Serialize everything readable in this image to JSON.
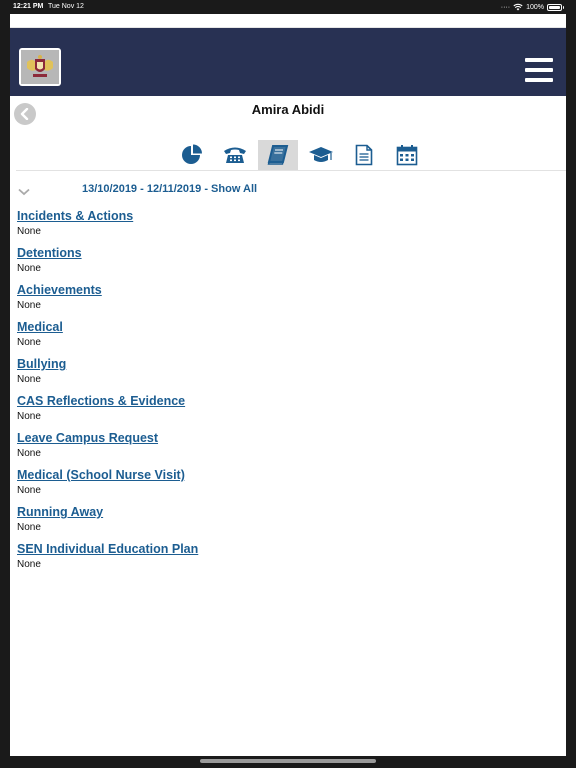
{
  "status_bar": {
    "time": "12:21 PM",
    "date": "Tue Nov 12",
    "signal": "····",
    "battery": "100%"
  },
  "header": {
    "menu_icon": "hamburger-icon",
    "logo_icon": "school-crest-icon"
  },
  "student": {
    "name": "Amira Abidi"
  },
  "tabs": [
    {
      "icon": "pie-chart-icon"
    },
    {
      "icon": "telephone-icon"
    },
    {
      "icon": "book-icon",
      "active": true
    },
    {
      "icon": "graduation-cap-icon"
    },
    {
      "icon": "document-icon"
    },
    {
      "icon": "calendar-icon"
    }
  ],
  "filter": {
    "range": "13/10/2019 - 12/11/2019 - Show All"
  },
  "sections": [
    {
      "title": "Incidents & Actions",
      "value": "None"
    },
    {
      "title": "Detentions",
      "value": "None"
    },
    {
      "title": "Achievements",
      "value": "None"
    },
    {
      "title": "Medical",
      "value": "None"
    },
    {
      "title": "Bullying",
      "value": "None"
    },
    {
      "title": "CAS Reflections & Evidence",
      "value": "None"
    },
    {
      "title": "Leave Campus Request",
      "value": "None"
    },
    {
      "title": "Medical (School Nurse Visit)",
      "value": "None"
    },
    {
      "title": "Running Away",
      "value": "None"
    },
    {
      "title": "SEN Individual Education Plan",
      "value": "None"
    }
  ],
  "colors": {
    "header_bg": "#283153",
    "link": "#1c5d91",
    "icon_blue": "#1c5d91"
  }
}
